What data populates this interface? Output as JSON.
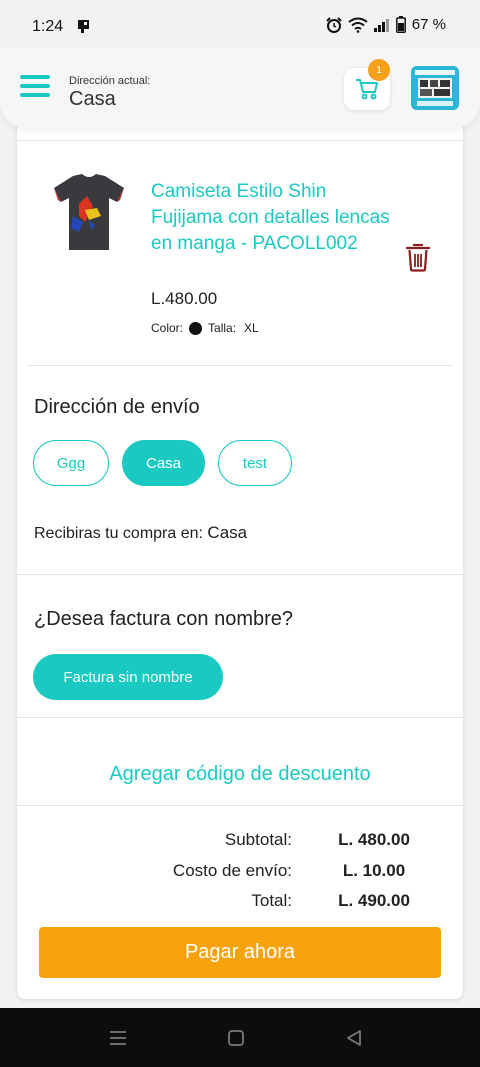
{
  "status_bar": {
    "time": "1:24",
    "battery": "67 %"
  },
  "header": {
    "address_label": "Dirección actual:",
    "address_value": "Casa",
    "cart_count": "1",
    "accent_color": "#1bc9c3",
    "badge_color": "#f7a11a"
  },
  "product": {
    "name": "Camiseta Estilo Shin Fujijama con detalles lencas en manga - PACOLL002",
    "price": "L.480.00",
    "color_label": "Color:",
    "color_value": "#111111",
    "size_label": "Talla:",
    "size_value": "XL"
  },
  "shipping": {
    "title": "Dirección de envío",
    "addresses": [
      {
        "label": "Ggg",
        "selected": false
      },
      {
        "label": "Casa",
        "selected": true
      },
      {
        "label": "test",
        "selected": false
      }
    ],
    "receive_label": "Recibiras tu compra en:",
    "receive_value": "Casa"
  },
  "invoice": {
    "title": "¿Desea factura con nombre?",
    "button_label": "Factura sin nombre"
  },
  "discount": {
    "link_label": "Agregar código de descuento"
  },
  "totals": {
    "subtotal_label": "Subtotal:",
    "subtotal_value": "L. 480.00",
    "shipping_label": "Costo de envío:",
    "shipping_value": "L. 10.00",
    "total_label": "Total:",
    "total_value": "L. 490.00"
  },
  "pay_button": {
    "label": "Pagar ahora",
    "color": "#f9a30c"
  }
}
